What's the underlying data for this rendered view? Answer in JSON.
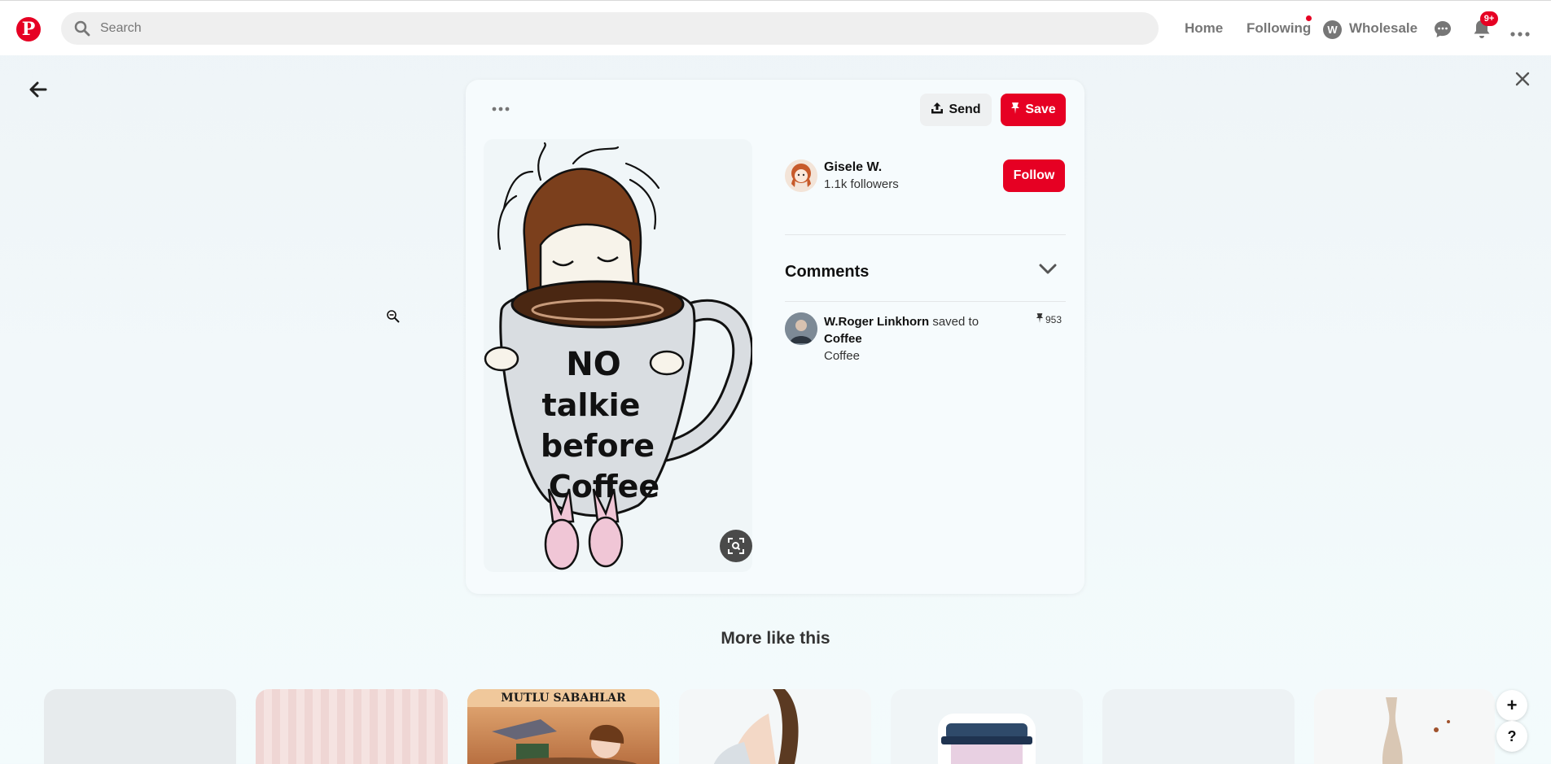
{
  "header": {
    "logo_letter": "P",
    "search_placeholder": "Search",
    "nav": {
      "home": "Home",
      "following": "Following",
      "wholesale": "Wholesale",
      "wholesale_initial": "W"
    },
    "notifications_badge": "9+"
  },
  "pin": {
    "send_label": "Send",
    "save_label": "Save",
    "image_text": [
      "NO",
      "talkie",
      "before",
      "Coffee"
    ],
    "creator": {
      "name": "Gisele W.",
      "followers": "1.1k followers",
      "follow_label": "Follow"
    },
    "comments_title": "Comments",
    "activity": {
      "user": "W.Roger Linkhorn",
      "action": "saved to",
      "board": "Coffee",
      "board_sub": "Coffee",
      "repin_count": "953"
    }
  },
  "more_like_this": {
    "title": "More like this",
    "tile_caption": "MUTLU SABAHLAR"
  },
  "floating": {
    "add": "+",
    "help": "?"
  },
  "colors": {
    "brand": "#e60023",
    "background": "#f2f8fa"
  }
}
